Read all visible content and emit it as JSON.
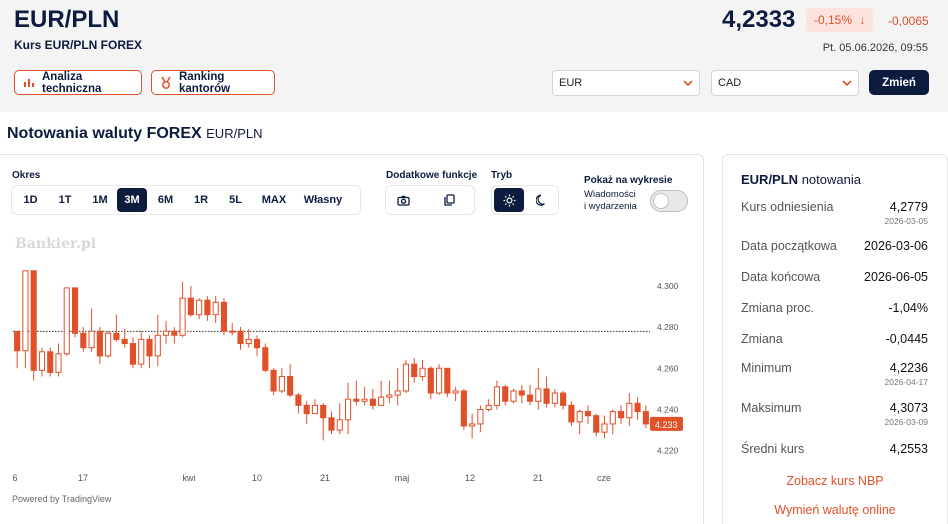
{
  "header": {
    "pair": "EUR/PLN",
    "subtitle": "Kurs EUR/PLN FOREX",
    "price": "4,2333",
    "change_pct": "-0,15%",
    "change_abs": "-0,0065",
    "timestamp": "Pt. 05.06.2026, 09:55",
    "down_color": "#e0512a"
  },
  "actions": {
    "technical": "Analiza techniczna",
    "ranking": "Ranking kantorów"
  },
  "converter": {
    "from": "EUR",
    "to": "CAD",
    "submit": "Zmień"
  },
  "section": {
    "title": "Notowania waluty FOREX",
    "pair": "EUR/PLN"
  },
  "controls": {
    "period_label": "Okres",
    "periods": [
      "1D",
      "1T",
      "1M",
      "3M",
      "6M",
      "1R",
      "5L",
      "MAX",
      "Własny"
    ],
    "active_period": "3M",
    "extra_label": "Dodatkowe funkcje",
    "mode_label": "Tryb",
    "show_label": "Pokaż na wykresie",
    "events_line1": "Wiadomości",
    "events_line2": "i wydarzenia",
    "events_enabled": false,
    "icons": [
      "camera-icon",
      "copy-icon",
      "sun-icon",
      "moon-icon"
    ]
  },
  "chart": {
    "watermark": "Bankier.pl",
    "powered": "Powered by TradingView",
    "last_label": "4.233"
  },
  "chart_data": {
    "type": "candlestick",
    "y_ticks": [
      "4.300",
      "4.280",
      "4.260",
      "4.240",
      "4.220"
    ],
    "ylim": [
      4.2155,
      4.3135
    ],
    "x_ticks": [
      "6",
      "17",
      "kwi",
      "10",
      "21",
      "maj",
      "12",
      "21",
      "cze"
    ],
    "last_price": 4.233,
    "reference_line": 4.2779,
    "grid": false,
    "candles": [
      [
        4.2779,
        4.2685,
        4.271,
        4.26
      ],
      [
        4.2685,
        4.3073,
        4.3073,
        4.26
      ],
      [
        4.3073,
        4.259,
        4.3073,
        4.254
      ],
      [
        4.259,
        4.268,
        4.27,
        4.256
      ],
      [
        4.268,
        4.258,
        4.27,
        4.256
      ],
      [
        4.258,
        4.267,
        4.272,
        4.256
      ],
      [
        4.267,
        4.299,
        4.299,
        4.266
      ],
      [
        4.299,
        4.277,
        4.299,
        4.275
      ],
      [
        4.277,
        4.27,
        4.28,
        4.268
      ],
      [
        4.27,
        4.278,
        4.289,
        4.268
      ],
      [
        4.278,
        4.266,
        4.28,
        4.262
      ],
      [
        4.266,
        4.277,
        4.278,
        4.265
      ],
      [
        4.277,
        4.274,
        4.286,
        4.273
      ],
      [
        4.274,
        4.272,
        4.279,
        4.27
      ],
      [
        4.272,
        4.262,
        4.275,
        4.26
      ],
      [
        4.262,
        4.274,
        4.278,
        4.26
      ],
      [
        4.274,
        4.266,
        4.276,
        4.26
      ],
      [
        4.266,
        4.276,
        4.286,
        4.261
      ],
      [
        4.276,
        4.278,
        4.283,
        4.272
      ],
      [
        4.278,
        4.276,
        4.28,
        4.272
      ],
      [
        4.276,
        4.294,
        4.302,
        4.275
      ],
      [
        4.294,
        4.286,
        4.3,
        4.285
      ],
      [
        4.286,
        4.293,
        4.294,
        4.284
      ],
      [
        4.293,
        4.286,
        4.295,
        4.283
      ],
      [
        4.286,
        4.292,
        4.295,
        4.282
      ],
      [
        4.292,
        4.278,
        4.294,
        4.276
      ],
      [
        4.278,
        4.278,
        4.282,
        4.276
      ],
      [
        4.278,
        4.272,
        4.28,
        4.269
      ],
      [
        4.272,
        4.274,
        4.279,
        4.27
      ],
      [
        4.274,
        4.27,
        4.276,
        4.266
      ],
      [
        4.27,
        4.259,
        4.272,
        4.258
      ],
      [
        4.259,
        4.249,
        4.26,
        4.247
      ],
      [
        4.249,
        4.256,
        4.26,
        4.248
      ],
      [
        4.256,
        4.247,
        4.262,
        4.246
      ],
      [
        4.247,
        4.242,
        4.248,
        4.238
      ],
      [
        4.242,
        4.238,
        4.244,
        4.233
      ],
      [
        4.238,
        4.242,
        4.245,
        4.238
      ],
      [
        4.242,
        4.236,
        4.243,
        4.225
      ],
      [
        4.236,
        4.23,
        4.239,
        4.228
      ],
      [
        4.23,
        4.235,
        4.243,
        4.228
      ],
      [
        4.235,
        4.245,
        4.253,
        4.228
      ],
      [
        4.245,
        4.244,
        4.254,
        4.242
      ],
      [
        4.244,
        4.245,
        4.251,
        4.242
      ],
      [
        4.245,
        4.242,
        4.25,
        4.24
      ],
      [
        4.242,
        4.246,
        4.254,
        4.242
      ],
      [
        4.246,
        4.247,
        4.254,
        4.243
      ],
      [
        4.247,
        4.249,
        4.26,
        4.242
      ],
      [
        4.249,
        4.262,
        4.264,
        4.248
      ],
      [
        4.262,
        4.256,
        4.265,
        4.253
      ],
      [
        4.256,
        4.26,
        4.264,
        4.254
      ],
      [
        4.26,
        4.248,
        4.261,
        4.245
      ],
      [
        4.248,
        4.26,
        4.262,
        4.247
      ],
      [
        4.26,
        4.248,
        4.26,
        4.246
      ],
      [
        4.248,
        4.249,
        4.251,
        4.244
      ],
      [
        4.249,
        4.232,
        4.25,
        4.23
      ],
      [
        4.232,
        4.233,
        4.238,
        4.226
      ],
      [
        4.233,
        4.24,
        4.242,
        4.229
      ],
      [
        4.24,
        4.242,
        4.245,
        4.239
      ],
      [
        4.242,
        4.251,
        4.254,
        4.24
      ],
      [
        4.251,
        4.244,
        4.252,
        4.242
      ],
      [
        4.244,
        4.249,
        4.25,
        4.243
      ],
      [
        4.249,
        4.247,
        4.252,
        4.243
      ],
      [
        4.247,
        4.244,
        4.252,
        4.242
      ],
      [
        4.244,
        4.25,
        4.26,
        4.24
      ],
      [
        4.25,
        4.243,
        4.256,
        4.241
      ],
      [
        4.243,
        4.248,
        4.25,
        4.241
      ],
      [
        4.248,
        4.242,
        4.249,
        4.24
      ],
      [
        4.242,
        4.234,
        4.244,
        4.232
      ],
      [
        4.234,
        4.239,
        4.24,
        4.228
      ],
      [
        4.239,
        4.237,
        4.242,
        4.233
      ],
      [
        4.237,
        4.229,
        4.238,
        4.227
      ],
      [
        4.229,
        4.233,
        4.237,
        4.226
      ],
      [
        4.233,
        4.239,
        4.24,
        4.228
      ],
      [
        4.239,
        4.236,
        4.242,
        4.233
      ],
      [
        4.236,
        4.243,
        4.248,
        4.232
      ],
      [
        4.243,
        4.239,
        4.246,
        4.235
      ],
      [
        4.239,
        4.233,
        4.242,
        4.231
      ]
    ]
  },
  "stats": {
    "title_pair": "EUR/PLN",
    "title_rest": "notowania",
    "rows": [
      {
        "label": "Kurs odniesienia",
        "value": "4,2779",
        "date": "2026-03-05"
      },
      {
        "label": "Data początkowa",
        "value": "2026-03-06",
        "date": ""
      },
      {
        "label": "Data końcowa",
        "value": "2026-06-05",
        "date": ""
      },
      {
        "label": "Zmiana proc.",
        "value": "-1,04%",
        "date": ""
      },
      {
        "label": "Zmiana",
        "value": "-0,0445",
        "date": ""
      },
      {
        "label": "Minimum",
        "value": "4,2236",
        "date": "2026-04-17"
      },
      {
        "label": "Maksimum",
        "value": "4,3073",
        "date": "2026-03-09"
      },
      {
        "label": "Średni kurs",
        "value": "4,2553",
        "date": ""
      }
    ],
    "link_nbp": "Zobacz kurs NBP",
    "link_exchange": "Wymień walutę online"
  }
}
